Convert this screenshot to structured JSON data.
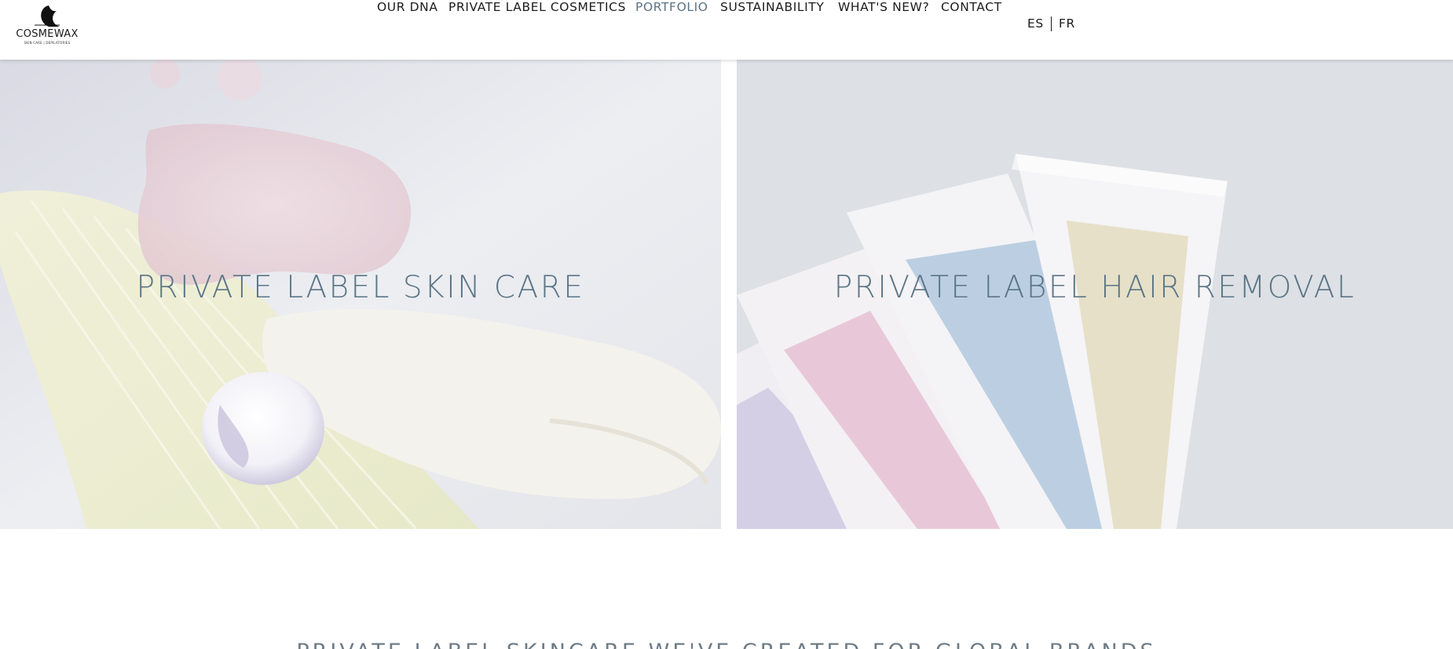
{
  "logo": {
    "wordmark": "COSMEWAX",
    "tagline": "SKIN CARE | DEPILATORIES"
  },
  "nav": {
    "items": [
      {
        "label": "OUR DNA"
      },
      {
        "label": "PRIVATE LABEL COSMETICS"
      },
      {
        "label": "PORTFOLIO",
        "active": true
      },
      {
        "label": "SUSTAINABILITY"
      },
      {
        "label": "WHAT'S NEW?"
      },
      {
        "label": "CONTACT"
      }
    ],
    "languages": [
      "ES",
      "FR"
    ]
  },
  "hero": {
    "left": {
      "title": "PRIVATE LABEL SKIN CARE"
    },
    "right": {
      "title": "PRIVATE LABEL HAIR REMOVAL"
    }
  },
  "section": {
    "heading": "PRIVATE LABEL SKINCARE WE'VE CREATED FOR GLOBAL BRANDS"
  },
  "colors": {
    "nav_active": "#5c7384",
    "hero_title": "#5b7586",
    "strip_pink": "#e8c8d8",
    "strip_blue": "#bccfe2",
    "strip_beige": "#e6e0c8",
    "strip_lavender": "#d4cfe5"
  }
}
